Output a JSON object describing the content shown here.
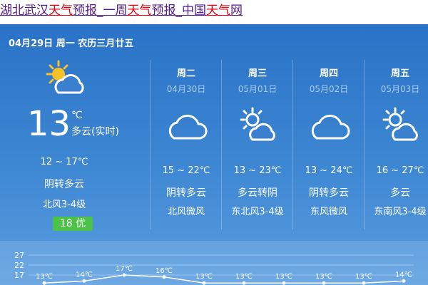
{
  "header_link": {
    "parts": [
      {
        "text": "湖北",
        "hl": false
      },
      {
        "text": "武汉",
        "hl": false
      },
      {
        "text": "天气",
        "hl": true
      },
      {
        "text": "预报_一周",
        "hl": false
      },
      {
        "text": "天气",
        "hl": true
      },
      {
        "text": "预报_中国",
        "hl": false
      },
      {
        "text": "天气",
        "hl": true
      },
      {
        "text": "网",
        "hl": false
      }
    ]
  },
  "today": {
    "date_line": "04月29日 周一 农历三月廿五",
    "icon": "partly-cloudy-sun-icon",
    "temp": "13",
    "unit": "℃",
    "condition_now": "多云(实时)",
    "range": "12 ~ 17℃",
    "desc": "阴转多云",
    "wind": "北风3-4级",
    "aqi": "18 优",
    "aqi_color": "#4cc24b"
  },
  "forecast": [
    {
      "weekday": "周二",
      "date": "04月30日",
      "icon": "cloud-icon",
      "range": "15 ~ 22℃",
      "desc": "阴转多云",
      "wind": "北风微风"
    },
    {
      "weekday": "周三",
      "date": "05月01日",
      "icon": "partly-cloudy-sun-icon",
      "range": "13 ~ 23℃",
      "desc": "多云转阴",
      "wind": "东北风3-4级"
    },
    {
      "weekday": "周四",
      "date": "05月02日",
      "icon": "cloud-icon",
      "range": "13 ~ 24℃",
      "desc": "阴转多云",
      "wind": "东风微风"
    },
    {
      "weekday": "周五",
      "date": "05月03日",
      "icon": "partly-cloudy-sun-icon",
      "range": "16 ~ 27℃",
      "desc": "多云",
      "wind": "东南风3-4级"
    }
  ],
  "colors": {
    "panel_top": "#2a72c6",
    "panel_bottom": "#5b9ee0",
    "link_color": "#551a8b",
    "highlight_color": "#e4000f",
    "sun_color": "#f5c22a"
  },
  "chart_data": {
    "type": "line",
    "ytick_labels": [
      "27",
      "22",
      "17"
    ],
    "ylim": [
      12,
      27
    ],
    "series": [
      {
        "values": [
          13,
          14,
          17,
          16,
          13,
          13,
          13,
          13,
          13,
          14
        ],
        "labels": [
          "13℃",
          "14℃",
          "17℃",
          "16℃",
          "13℃",
          "13℃",
          "13℃",
          "13℃",
          "13℃",
          "14℃"
        ]
      }
    ]
  }
}
